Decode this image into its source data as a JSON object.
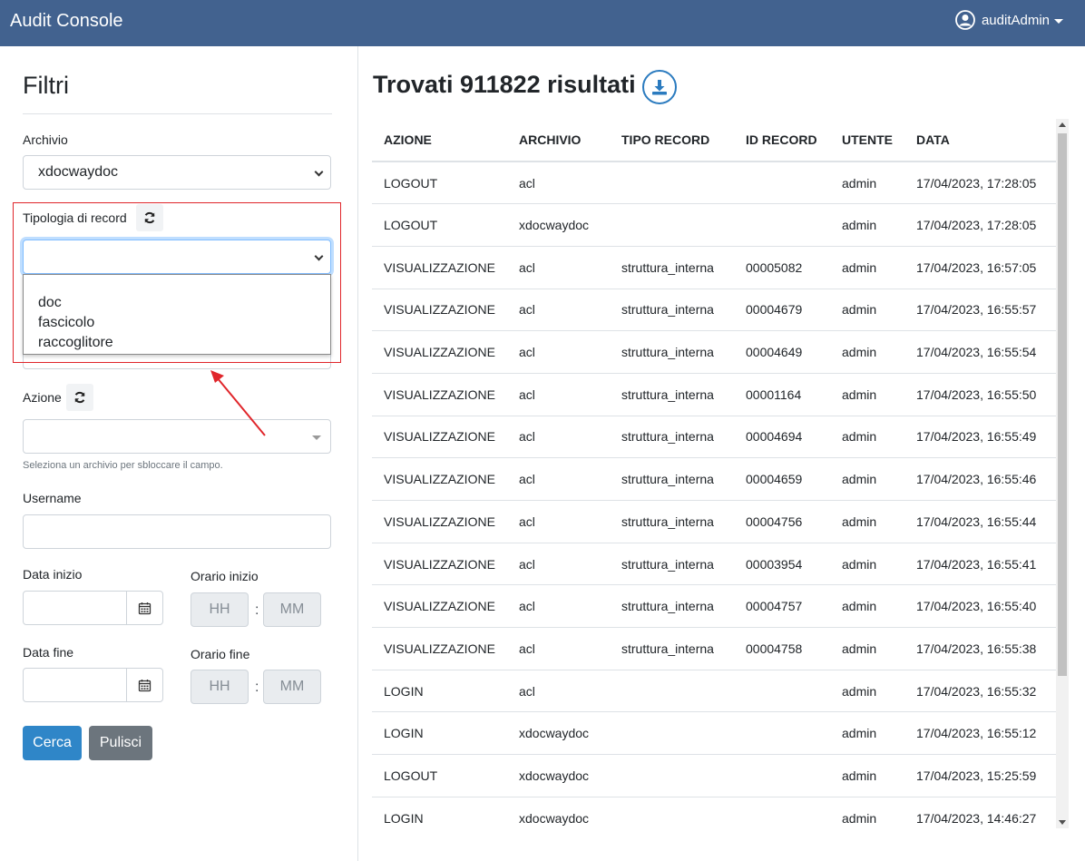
{
  "header": {
    "brand": "Audit Console",
    "user": "auditAdmin"
  },
  "filters": {
    "title": "Filtri",
    "archivio": {
      "label": "Archivio",
      "value": "xdocwaydoc"
    },
    "tipologia": {
      "label": "Tipologia di record",
      "value": "",
      "options": [
        "doc",
        "fascicolo",
        "raccoglitore"
      ]
    },
    "azione": {
      "label": "Azione",
      "value": "",
      "hint": "Seleziona un archivio per sbloccare il campo."
    },
    "username": {
      "label": "Username",
      "value": ""
    },
    "data_inizio": {
      "label": "Data inizio"
    },
    "orario_inizio": {
      "label": "Orario inizio",
      "hh_placeholder": "HH",
      "mm_placeholder": "MM"
    },
    "data_fine": {
      "label": "Data fine"
    },
    "orario_fine": {
      "label": "Orario fine",
      "hh_placeholder": "HH",
      "mm_placeholder": "MM"
    },
    "search_label": "Cerca",
    "clear_label": "Pulisci"
  },
  "results": {
    "title": "Trovati 911822 risultati",
    "columns": [
      "AZIONE",
      "ARCHIVIO",
      "TIPO RECORD",
      "ID RECORD",
      "UTENTE",
      "DATA"
    ],
    "rows": [
      [
        "LOGOUT",
        "acl",
        "",
        "",
        "admin",
        "17/04/2023, 17:28:05"
      ],
      [
        "LOGOUT",
        "xdocwaydoc",
        "",
        "",
        "admin",
        "17/04/2023, 17:28:05"
      ],
      [
        "VISUALIZZAZIONE",
        "acl",
        "struttura_interna",
        "00005082",
        "admin",
        "17/04/2023, 16:57:05"
      ],
      [
        "VISUALIZZAZIONE",
        "acl",
        "struttura_interna",
        "00004679",
        "admin",
        "17/04/2023, 16:55:57"
      ],
      [
        "VISUALIZZAZIONE",
        "acl",
        "struttura_interna",
        "00004649",
        "admin",
        "17/04/2023, 16:55:54"
      ],
      [
        "VISUALIZZAZIONE",
        "acl",
        "struttura_interna",
        "00001164",
        "admin",
        "17/04/2023, 16:55:50"
      ],
      [
        "VISUALIZZAZIONE",
        "acl",
        "struttura_interna",
        "00004694",
        "admin",
        "17/04/2023, 16:55:49"
      ],
      [
        "VISUALIZZAZIONE",
        "acl",
        "struttura_interna",
        "00004659",
        "admin",
        "17/04/2023, 16:55:46"
      ],
      [
        "VISUALIZZAZIONE",
        "acl",
        "struttura_interna",
        "00004756",
        "admin",
        "17/04/2023, 16:55:44"
      ],
      [
        "VISUALIZZAZIONE",
        "acl",
        "struttura_interna",
        "00003954",
        "admin",
        "17/04/2023, 16:55:41"
      ],
      [
        "VISUALIZZAZIONE",
        "acl",
        "struttura_interna",
        "00004757",
        "admin",
        "17/04/2023, 16:55:40"
      ],
      [
        "VISUALIZZAZIONE",
        "acl",
        "struttura_interna",
        "00004758",
        "admin",
        "17/04/2023, 16:55:38"
      ],
      [
        "LOGIN",
        "acl",
        "",
        "",
        "admin",
        "17/04/2023, 16:55:32"
      ],
      [
        "LOGIN",
        "xdocwaydoc",
        "",
        "",
        "admin",
        "17/04/2023, 16:55:12"
      ],
      [
        "LOGOUT",
        "xdocwaydoc",
        "",
        "",
        "admin",
        "17/04/2023, 15:25:59"
      ],
      [
        "LOGIN",
        "xdocwaydoc",
        "",
        "",
        "admin",
        "17/04/2023, 14:46:27"
      ]
    ]
  },
  "colors": {
    "navbar": "#42628f",
    "primary": "#2f86c8",
    "secondary": "#6c757d",
    "highlight": "#e0262b"
  }
}
